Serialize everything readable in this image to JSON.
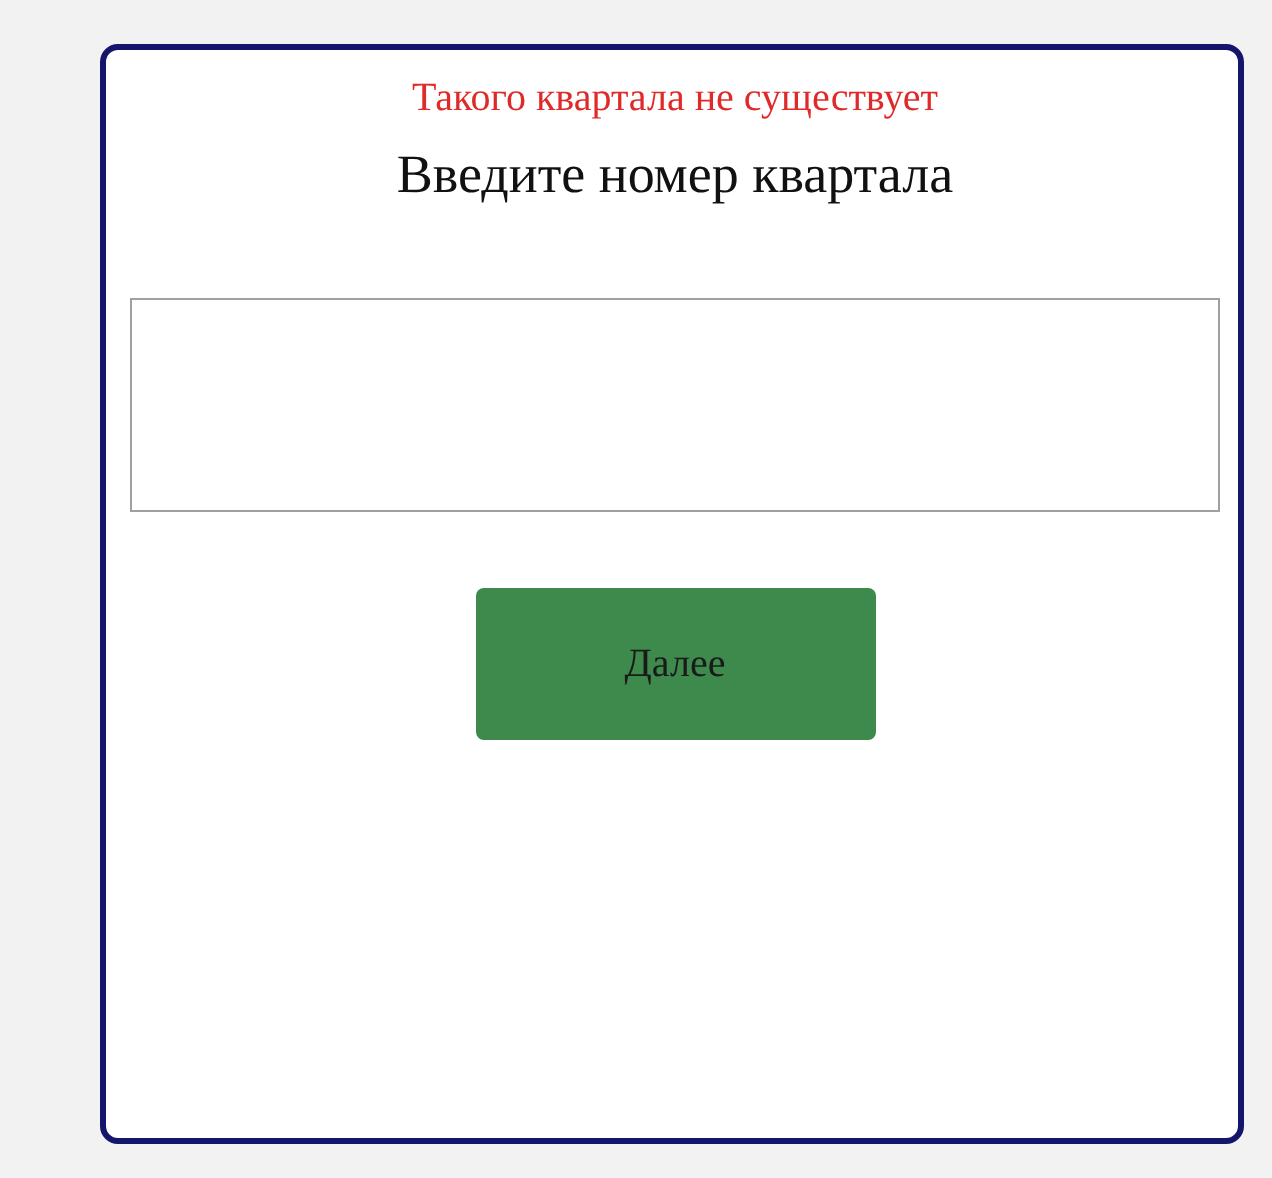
{
  "error_message": "Такого квартала не существует",
  "title": "Введите номер квартала",
  "button": "Далее"
}
